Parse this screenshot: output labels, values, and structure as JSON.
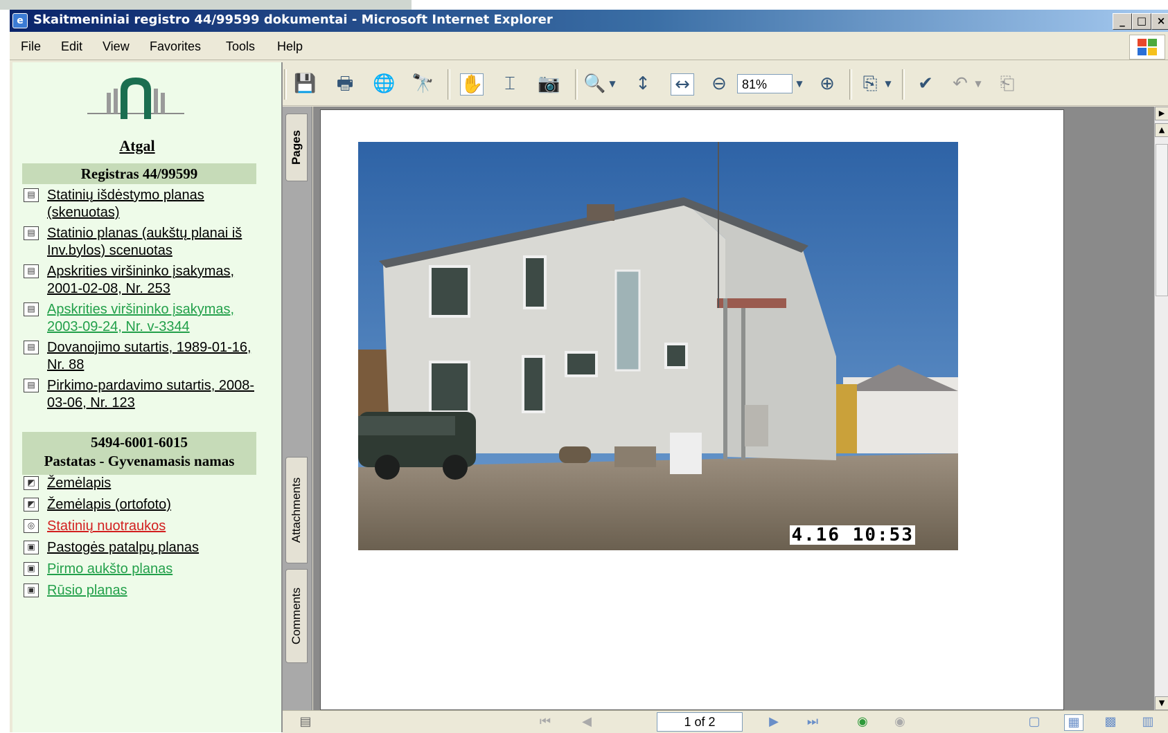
{
  "window": {
    "title": "Skaitmeniniai registro 44/99599 dokumentai - Microsoft Internet Explorer",
    "controls": {
      "minimize": "_",
      "maximize": "□",
      "close": "×"
    }
  },
  "menu": [
    "File",
    "Edit",
    "View",
    "Favorites",
    "Tools",
    "Help"
  ],
  "sidebar": {
    "back_label": "Atgal",
    "register_heading": "Registras 44/99599",
    "documents": [
      {
        "label": "Statinių išdėstymo planas (skenuotas)",
        "icon": "document-icon",
        "color": "#000000"
      },
      {
        "label": "Statinio planas (aukštų planai iš Inv.bylos) scenuotas",
        "icon": "document-icon",
        "color": "#000000"
      },
      {
        "label": "Apskrities viršininko įsakymas, 2001-02-08, Nr. 253",
        "icon": "document-icon",
        "color": "#000000"
      },
      {
        "label": "Apskrities viršininko įsakymas, 2003-09-24, Nr. v-3344",
        "icon": "document-icon",
        "color": "#22a04a"
      },
      {
        "label": "Dovanojimo sutartis, 1989-01-16, Nr. 88",
        "icon": "document-icon",
        "color": "#000000"
      },
      {
        "label": "Pirkimo-pardavimo sutartis, 2008-03-06, Nr. 123",
        "icon": "document-icon",
        "color": "#000000"
      }
    ],
    "building_code": "5494-6001-6015",
    "building_type": "Pastatas - Gyvenamasis namas",
    "building_items": [
      {
        "label": "Žemėlapis",
        "icon": "map-icon",
        "color": "#000000"
      },
      {
        "label": "Žemėlapis (ortofoto)",
        "icon": "map-icon",
        "color": "#000000"
      },
      {
        "label": "Statinių nuotraukos",
        "icon": "photo-icon",
        "color": "#d21f1f"
      },
      {
        "label": "Pastogės patalpų planas",
        "icon": "plan-icon",
        "color": "#000000"
      },
      {
        "label": "Pirmo aukšto planas",
        "icon": "plan-icon",
        "color": "#22a04a"
      },
      {
        "label": "Rūsio planas",
        "icon": "plan-icon",
        "color": "#22a04a"
      }
    ]
  },
  "viewer": {
    "zoom": "81%",
    "side_tabs": [
      "Pages",
      "Attachments",
      "Comments"
    ],
    "photo_timestamp": "4.16  10:53",
    "page_indicator": "1 of 2"
  }
}
